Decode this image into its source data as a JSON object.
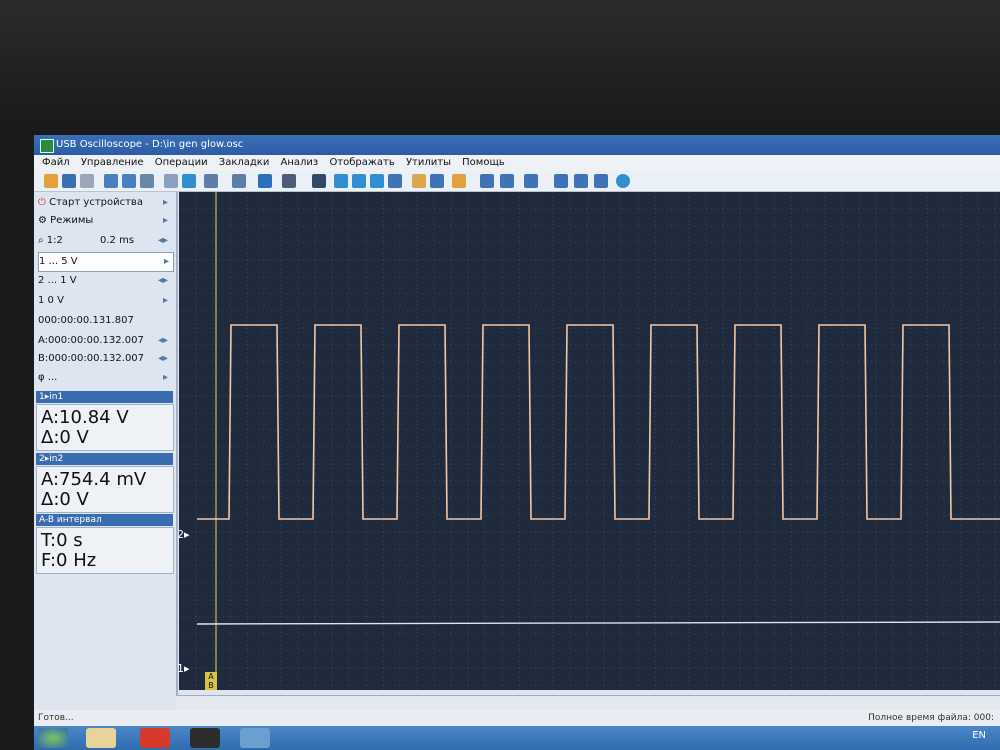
{
  "window": {
    "title": "USB Oscilloscope - D:\\in gen glow.osc"
  },
  "menu": [
    "Файл",
    "Управление",
    "Операции",
    "Закладки",
    "Анализ",
    "Отображать",
    "Утилиты",
    "Помощь"
  ],
  "left_panel": {
    "start_device": "Старт устройства",
    "modes": "Режимы",
    "zoom": "1:2",
    "timebase": "0.2 ms",
    "ch1": "1 ... 5 V",
    "ch2": "2 ... 1 V",
    "trigger": "1 0 V",
    "cursor_time": "000:00:00.131.807",
    "cursor_a": "A:000:00:00.132.007",
    "cursor_b": "B:000:00:00.132.007",
    "phi": "φ ..."
  },
  "meas1": {
    "header": "1▸in1",
    "a": "A:10.84 V",
    "delta": "Δ:0 V"
  },
  "meas2": {
    "header": "2▸in2",
    "a": "A:754.4 mV",
    "delta": "Δ:0 V"
  },
  "interval": {
    "header": "A-B интервал",
    "t": "T:0 s",
    "f": "F:0 Hz"
  },
  "plot": {
    "ch2_marker": "2▸",
    "ch1_marker": "1▸",
    "cursor_label": "A B"
  },
  "status": {
    "left": "Готов...",
    "right": "Полное время файла: 000:"
  },
  "tray": {
    "lang": "EN"
  },
  "colors": {
    "wave": "#f6c7a4",
    "grid": "#4a5a74",
    "cursor": "#e7d35a",
    "flat": "#dfe6ef"
  },
  "chart_data": {
    "type": "line",
    "series": [
      {
        "name": "in1",
        "style": "square wave",
        "high_level": "high",
        "low_level": "low",
        "pulse_count": 9
      },
      {
        "name": "in2",
        "style": "flat line"
      }
    ]
  }
}
